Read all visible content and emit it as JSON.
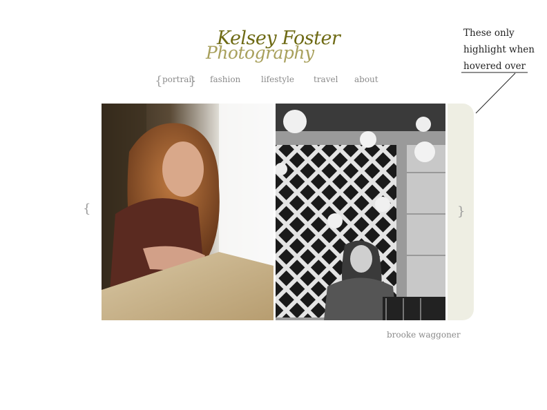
{
  "logo": {
    "line1": "Kelsey Foster",
    "line2": "Photography",
    "colors": {
      "line1": "#6e6a14",
      "line2": "#a8a05c"
    }
  },
  "nav": {
    "open_brace": "{",
    "close_brace": "}",
    "items": [
      {
        "label": "portrait"
      },
      {
        "label": "fashion"
      },
      {
        "label": "lifestyle"
      },
      {
        "label": "travel"
      },
      {
        "label": "about"
      }
    ]
  },
  "gallery": {
    "prev_arrow": "{",
    "next_arrow": "}",
    "next_panel_color": "#eeeee3",
    "caption": "brooke waggoner"
  },
  "annotation": {
    "lines": [
      "These only",
      "highlight when",
      "hovered over"
    ]
  }
}
